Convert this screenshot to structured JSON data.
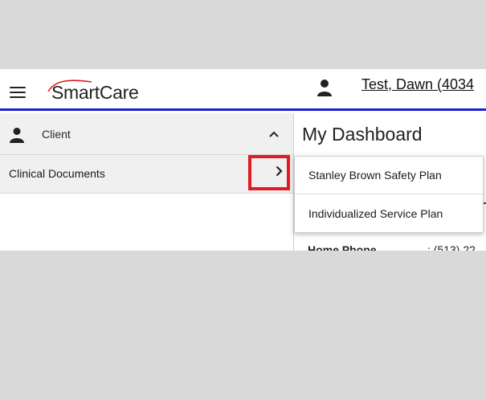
{
  "header": {
    "app_name": "SmartCare",
    "user_name": "Test, Dawn (4034"
  },
  "sidebar": {
    "section_label": "Client",
    "items": [
      {
        "label": "Clinical Documents"
      }
    ]
  },
  "main": {
    "title": "My Dashboard",
    "home_phone_label": "Home Phone",
    "home_phone_value": ": (513) 22"
  },
  "flyout": {
    "items": [
      {
        "label": "Stanley Brown Safety Plan"
      },
      {
        "label": "Individualized Service Plan"
      }
    ]
  },
  "colors": {
    "header_border": "#1c1fd6",
    "highlight_box": "#e11b22",
    "logo_swoosh": "#e11b22"
  },
  "icons": {
    "menu": "hamburger-menu-icon",
    "user": "user-icon",
    "collapse": "chevron-up-icon",
    "expand": "chevron-right-icon"
  }
}
